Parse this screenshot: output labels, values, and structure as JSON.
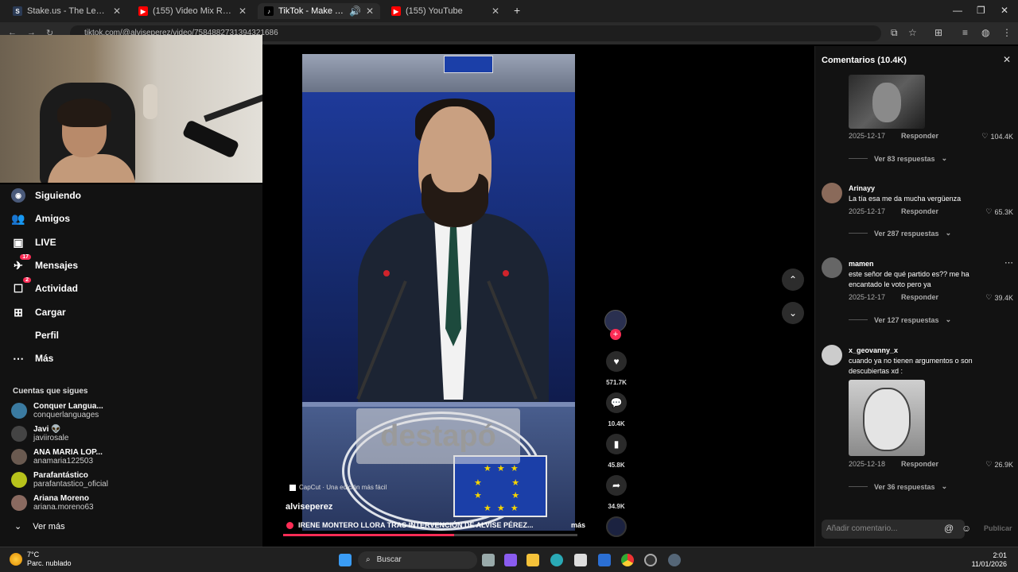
{
  "browser": {
    "tabs": [
      {
        "title": "Stake.us - The Leading Social C",
        "favicon": "S",
        "color": "#2b3b55"
      },
      {
        "title": "(155) Video Mix Reggaeton Vie",
        "favicon": "▶",
        "color": "#ff0000"
      },
      {
        "title": "TikTok - Make Your Day",
        "favicon": "♪",
        "color": "#000000"
      },
      {
        "title": "(155) YouTube",
        "favicon": "▶",
        "color": "#ff0000"
      }
    ],
    "new_tab": "+",
    "url": "tiktok.com/@alviseperez/video/7584882731394321686"
  },
  "nav": {
    "items": [
      {
        "label": "Siguiendo",
        "icon": "following-icon"
      },
      {
        "label": "Amigos",
        "icon": "friends-icon"
      },
      {
        "label": "LIVE",
        "icon": "live-icon"
      },
      {
        "label": "Mensajes",
        "icon": "messages-icon",
        "badge": "17"
      },
      {
        "label": "Actividad",
        "icon": "activity-icon",
        "badge": "2"
      },
      {
        "label": "Cargar",
        "icon": "upload-icon"
      },
      {
        "label": "Perfil",
        "icon": "profile-icon"
      },
      {
        "label": "Más",
        "icon": "more-icon"
      }
    ],
    "following_title": "Cuentas que sigues",
    "accounts": [
      {
        "name": "Conquer Langua...",
        "user": "conquerlanguages",
        "color": "#3a7aa0"
      },
      {
        "name": "Javi 👽",
        "user": "javiirosale",
        "color": "#444"
      },
      {
        "name": "ANA MARIA LOP...",
        "user": "anamaria122503",
        "color": "#6a5a50"
      },
      {
        "name": "Parafantástico",
        "user": "parafantastico_oficial",
        "color": "#b7c21b"
      },
      {
        "name": "Ariana Moreno",
        "user": "ariana.moreno63",
        "color": "#8a6a60"
      }
    ],
    "see_more": "Ver más"
  },
  "video": {
    "overlay_text": "destapó",
    "capcut": "CapCut · Una edición más fácil",
    "author": "alviseperez",
    "description": "IRENE MONTERO LLORA TRAS INTERVENCIÓN DE ALVISE PÉREZ...",
    "more": "más",
    "progress": 0.58
  },
  "actions": {
    "likes": "571.7K",
    "comments": "10.4K",
    "saves": "45.8K",
    "shares": "34.9K"
  },
  "comments": {
    "title": "Comentarios (10.4K)",
    "reply_label": "Responder",
    "list": [
      {
        "date": "2025-12-17",
        "likes": "104.4K",
        "replies": "Ver 83 respuestas"
      },
      {
        "user": "Arinayy",
        "text": "La tía esa me da mucha vergüenza",
        "date": "2025-12-17",
        "likes": "65.3K",
        "replies": "Ver 287 respuestas"
      },
      {
        "user": "mamen",
        "text": "este señor de qué partido es?? me ha encantado le voto pero ya",
        "date": "2025-12-17",
        "likes": "39.4K",
        "replies": "Ver 127 respuestas"
      },
      {
        "user": "x_geovanny_x",
        "text": "cuando ya no tienen argumentos o son descubiertas xd :",
        "date": "2025-12-18",
        "likes": "26.9K",
        "replies": "Ver 36 respuestas"
      }
    ],
    "input_placeholder": "Añadir comentario...",
    "publish": "Publicar"
  },
  "taskbar": {
    "temp": "7°C",
    "weather": "Parc. nublado",
    "search": "Buscar",
    "time": "2:01",
    "date": "11/01/2026"
  }
}
